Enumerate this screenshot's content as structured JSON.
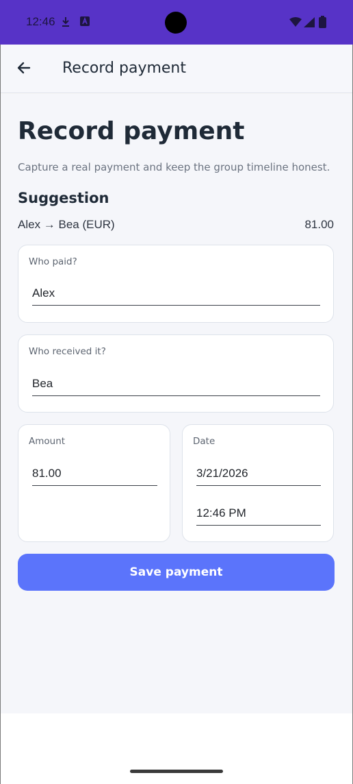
{
  "status_bar": {
    "time": "12:46",
    "left_icons": [
      "download-icon",
      "a11y-icon"
    ],
    "right_icons": [
      "wifi-icon",
      "signal-icon",
      "battery-icon"
    ]
  },
  "app_bar": {
    "back_icon": "arrow-left-icon",
    "title": "Record payment"
  },
  "page": {
    "title": "Record payment",
    "subtitle": "Capture a real payment and keep the group timeline honest."
  },
  "suggestion": {
    "heading": "Suggestion",
    "text": "Alex → Bea (EUR)",
    "amount": "81.00"
  },
  "form": {
    "who_paid": {
      "label": "Who paid?",
      "value": "Alex"
    },
    "who_received": {
      "label": "Who received it?",
      "value": "Bea"
    },
    "amount": {
      "label": "Amount",
      "value": "81.00"
    },
    "date": {
      "label": "Date",
      "date_value": "3/21/2026",
      "time_value": "12:46 PM"
    }
  },
  "actions": {
    "save_label": "Save payment"
  },
  "colors": {
    "status_bar": "#5733c7",
    "primary_button": "#5b74fb",
    "background": "#f5f6fa"
  }
}
